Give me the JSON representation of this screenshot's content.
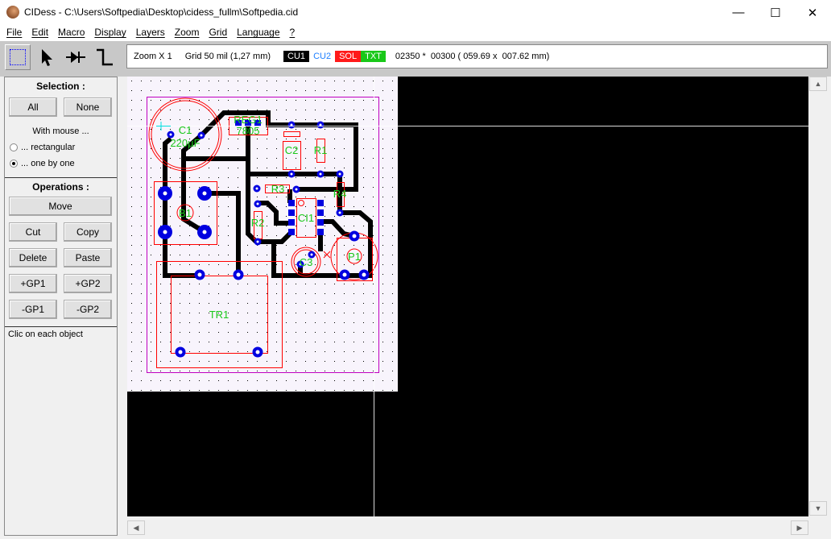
{
  "window": {
    "title": "CIDess - C:\\Users\\Softpedia\\Desktop\\cidess_fullm\\Softpedia.cid",
    "minimize": "—",
    "maximize": "☐",
    "close": "✕"
  },
  "menu": [
    "File",
    "Edit",
    "Macro",
    "Display",
    "Layers",
    "Zoom",
    "Grid",
    "Language",
    "?"
  ],
  "tools": [
    {
      "icon": "select-rect-icon",
      "active": true
    },
    {
      "icon": "pointer-icon"
    },
    {
      "icon": "component-icon"
    },
    {
      "icon": "track-icon"
    }
  ],
  "status": {
    "zoom": "Zoom X 1",
    "grid": "Grid 50 mil (1,27 mm)",
    "layers": [
      {
        "label": "CU1",
        "bg": "#000000",
        "fg": "#ffffff"
      },
      {
        "label": "CU2",
        "bg": "#ffffff",
        "fg": "#1e7fff"
      },
      {
        "label": "SOL",
        "bg": "#ff1a1a",
        "fg": "#ffffff"
      },
      {
        "label": "TXT",
        "bg": "#19c819",
        "fg": "#ffffff"
      }
    ],
    "coords": "02350 *  00300 ( 059.69 x  007.62 mm)"
  },
  "panel": {
    "selection_title": "Selection :",
    "all": "All",
    "none": "None",
    "with_mouse": "With mouse ...",
    "rect": "... rectangular",
    "one": "... one by one",
    "selected_mode": "one",
    "operations_title": "Operations :",
    "move": "Move",
    "cut": "Cut",
    "copy": "Copy",
    "delete": "Delete",
    "paste": "Paste",
    "gp1_add": "+GP1",
    "gp2_add": "+GP2",
    "gp1_rem": "-GP1",
    "gp2_rem": "-GP2",
    "hint": "Clic on each object"
  },
  "pcb": {
    "labels": {
      "c1": "C1",
      "c1v": "220µF",
      "reg1": "REG1",
      "reg1v": "7805",
      "c2": "C2",
      "r1": "R1",
      "r3": "R3",
      "r4": "R4",
      "r2": "R2",
      "ci1": "CI1",
      "b1": "B1",
      "c3": "C3",
      "p1": "P1",
      "tr1": "TR1"
    },
    "colors": {
      "track": "#000000",
      "pad": "#0000e0",
      "outline": "#ff0000",
      "label": "#19c819",
      "board": "#c000c0"
    }
  }
}
